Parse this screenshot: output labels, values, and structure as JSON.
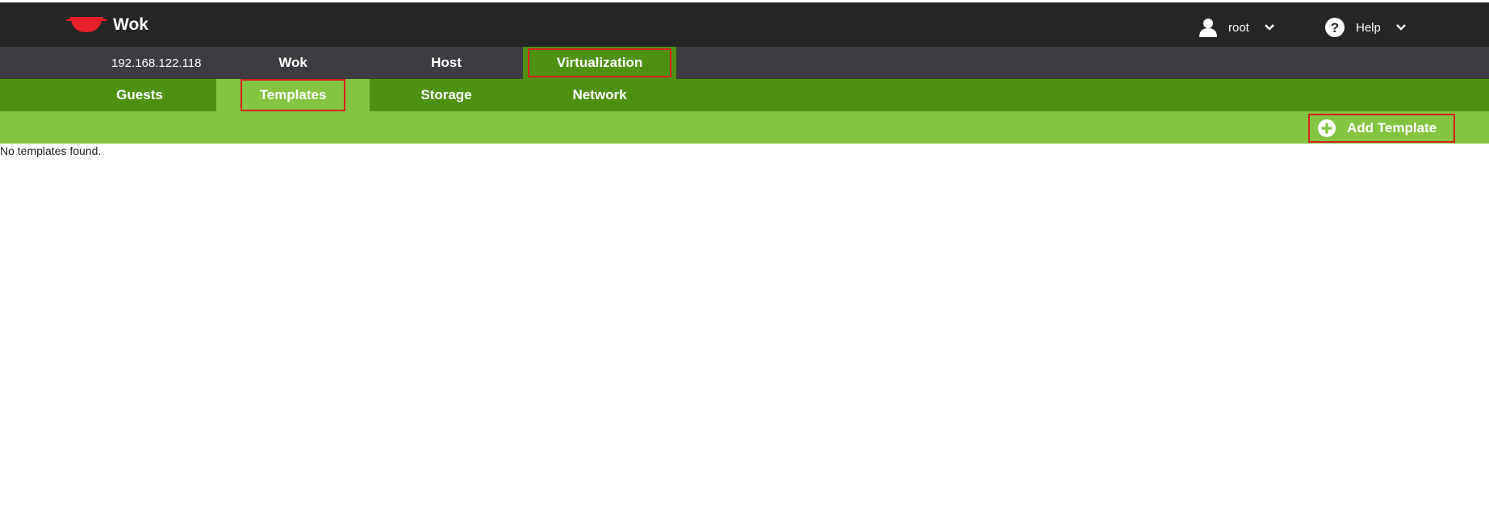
{
  "header": {
    "brand_name": "Wok",
    "user_label": "root",
    "help_label": "Help"
  },
  "host_nav": {
    "host_ip": "192.168.122.118",
    "tabs": [
      {
        "label": "Wok"
      },
      {
        "label": "Host"
      },
      {
        "label": "Virtualization",
        "active": true
      }
    ]
  },
  "sub_nav": {
    "tabs": [
      {
        "label": "Guests"
      },
      {
        "label": "Templates",
        "active": true
      },
      {
        "label": "Storage"
      },
      {
        "label": "Network"
      }
    ]
  },
  "toolbar": {
    "add_template_label": "Add Template"
  },
  "content": {
    "empty_message": "No templates found."
  },
  "colors": {
    "topbar": "#252525",
    "hostbar": "#3e3c40",
    "dark_green": "#4e9112",
    "light_green": "#83c440",
    "logo_red": "#e8202a",
    "highlight_red": "#d62020"
  },
  "icons": {
    "logo": "wok-logo-icon",
    "user": "user-icon",
    "help": "help-icon",
    "chevron": "chevron-down-icon",
    "add": "plus-circle-icon"
  }
}
